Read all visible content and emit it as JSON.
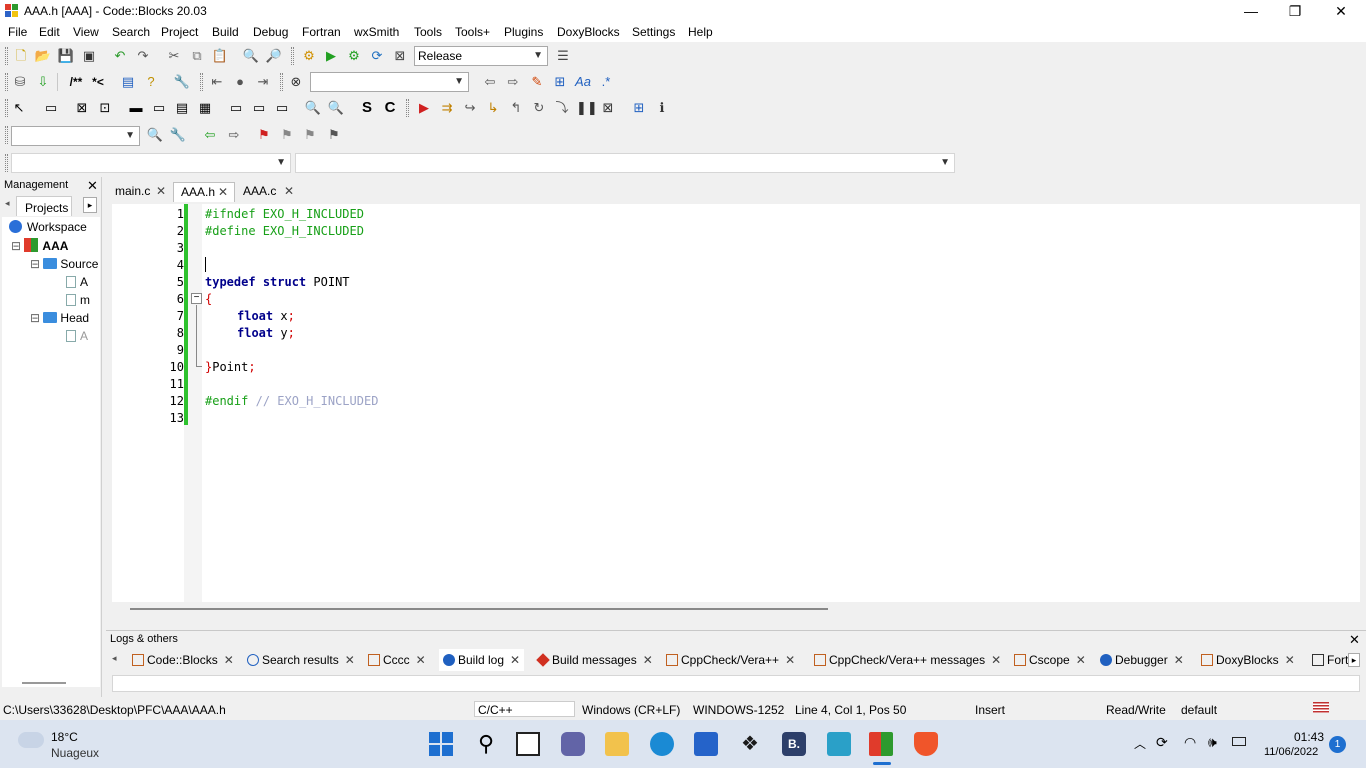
{
  "window": {
    "title": "AAA.h [AAA] - Code::Blocks 20.03"
  },
  "menu": [
    "File",
    "Edit",
    "View",
    "Search",
    "Project",
    "Build",
    "Debug",
    "Fortran",
    "wxSmith",
    "Tools",
    "Tools+",
    "Plugins",
    "DoxyBlocks",
    "Settings",
    "Help"
  ],
  "toolbar": {
    "build_target": "Release",
    "doxy_comment1": "/**",
    "doxy_comment2": "*<",
    "sel_S": "S",
    "sel_C": "C"
  },
  "management": {
    "title": "Management",
    "tab": "Projects",
    "tree": {
      "workspace": "Workspace",
      "project": "AAA",
      "sources": "Source",
      "src1": "A",
      "src2": "m",
      "headers": "Head",
      "hdr1": "A"
    }
  },
  "editor": {
    "tabs": [
      {
        "label": "main.c"
      },
      {
        "label": "AAA.h"
      },
      {
        "label": "AAA.c"
      }
    ],
    "lines": [
      "1",
      "2",
      "3",
      "4",
      "5",
      "6",
      "7",
      "8",
      "9",
      "10",
      "11",
      "12",
      "13"
    ],
    "code": {
      "l1": "#ifndef EXO_H_INCLUDED",
      "l2": "#define EXO_H_INCLUDED",
      "l5a": "typedef",
      "l5b": "struct",
      "l5c": " POINT",
      "l6": "{",
      "l7a": "float",
      "l7b": " x",
      "l7c": ";",
      "l8a": "float",
      "l8b": " y",
      "l8c": ";",
      "l10a": "}",
      "l10b": "Point",
      "l10c": ";",
      "l12a": "#endif",
      "l12b": "// EXO_H_INCLUDED"
    }
  },
  "logs": {
    "title": "Logs & others",
    "tabs": [
      "Code::Blocks",
      "Search results",
      "Cccc",
      "Build log",
      "Build messages",
      "CppCheck/Vera++",
      "CppCheck/Vera++ messages",
      "Cscope",
      "Debugger",
      "DoxyBlocks",
      "Fort"
    ]
  },
  "status": {
    "path": "C:\\Users\\33628\\Desktop\\PFC\\AAA\\AAA.h",
    "lang": "C/C++",
    "eol": "Windows (CR+LF)",
    "encoding": "WINDOWS-1252",
    "position": "Line 4, Col 1, Pos 50",
    "mode": "Insert",
    "access": "Read/Write",
    "profile": "default"
  },
  "taskbar": {
    "temp": "18°C",
    "weather": "Nuageux",
    "time": "01:43",
    "date": "11/06/2022",
    "badge": "1"
  }
}
